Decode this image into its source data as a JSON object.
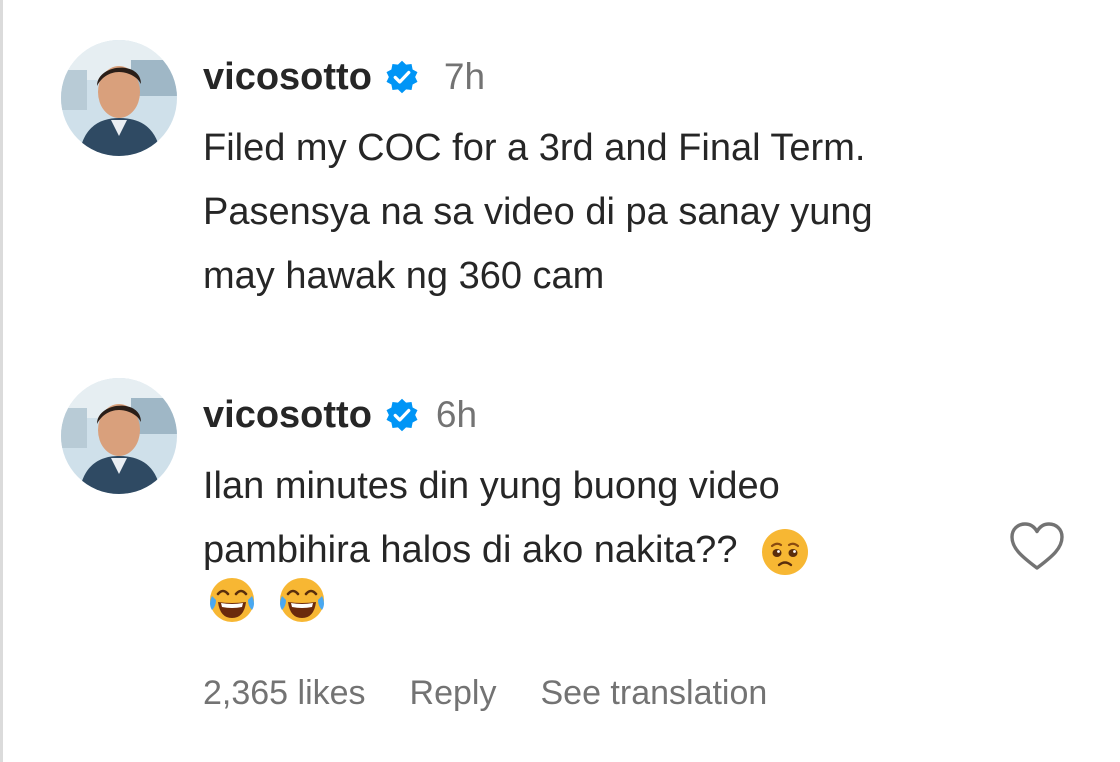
{
  "comments": [
    {
      "username": "vicosotto",
      "verified": true,
      "time": "7h",
      "lines": [
        "Filed my COC for a 3rd and Final Term.",
        "Pasensya na sa video di pa sanay yung",
        "may hawak ng 360 cam"
      ]
    },
    {
      "username": "vicosotto",
      "verified": true,
      "time": "6h",
      "lines": [
        "Ilan minutes din yung buong video",
        "pambihira halos di ako nakita??"
      ],
      "emoji_inline": "pleading-face-emoji",
      "emoji_row": [
        "tears-of-joy-emoji",
        "tears-of-joy-emoji"
      ],
      "likes": "2,365 likes",
      "reply_label": "Reply",
      "translation_label": "See translation"
    }
  ],
  "colors": {
    "verified_blue": "#0095f6",
    "secondary_text": "#737373",
    "primary_text": "#262626"
  }
}
